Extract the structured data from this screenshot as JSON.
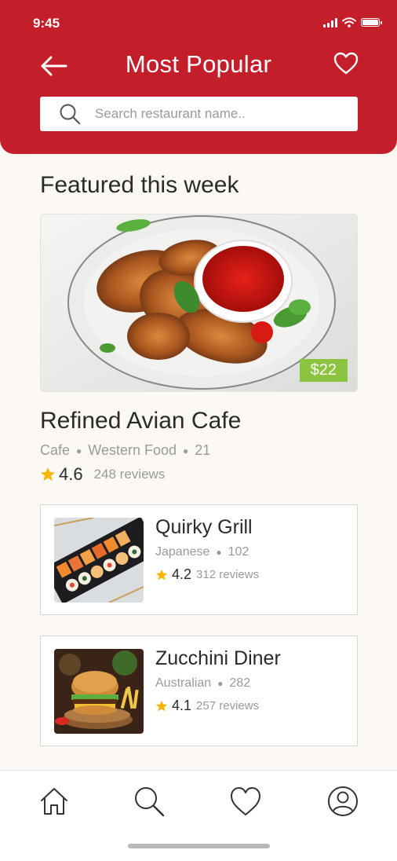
{
  "status_bar": {
    "time": "9:45"
  },
  "header": {
    "title": "Most Popular",
    "back_icon": "arrow-left-icon",
    "favorite_icon": "heart-icon"
  },
  "search": {
    "placeholder": "Search restaurant name..",
    "value": ""
  },
  "section_title": "Featured this week",
  "featured": {
    "price": "$22",
    "name": "Refined Avian Cafe",
    "category": "Cafe",
    "cuisine": "Western Food",
    "count": "21",
    "rating": "4.6",
    "reviews": "248 reviews",
    "image": "grilled-chicken-wings-photo"
  },
  "restaurants": [
    {
      "name": "Quirky Grill",
      "cuisine": "Japanese",
      "count": "102",
      "rating": "4.2",
      "reviews": "312 reviews",
      "image": "sushi-platter-photo"
    },
    {
      "name": "Zucchini Diner",
      "cuisine": "Australian",
      "count": "282",
      "rating": "4.1",
      "reviews": "257 reviews",
      "image": "burger-fries-photo"
    }
  ],
  "bottom_nav": [
    "home-icon",
    "search-icon",
    "heart-icon",
    "profile-icon"
  ],
  "colors": {
    "primary": "#c41e2a",
    "price_badge": "#8dc43f",
    "star": "#f7b500",
    "background": "#fcf9f4"
  }
}
